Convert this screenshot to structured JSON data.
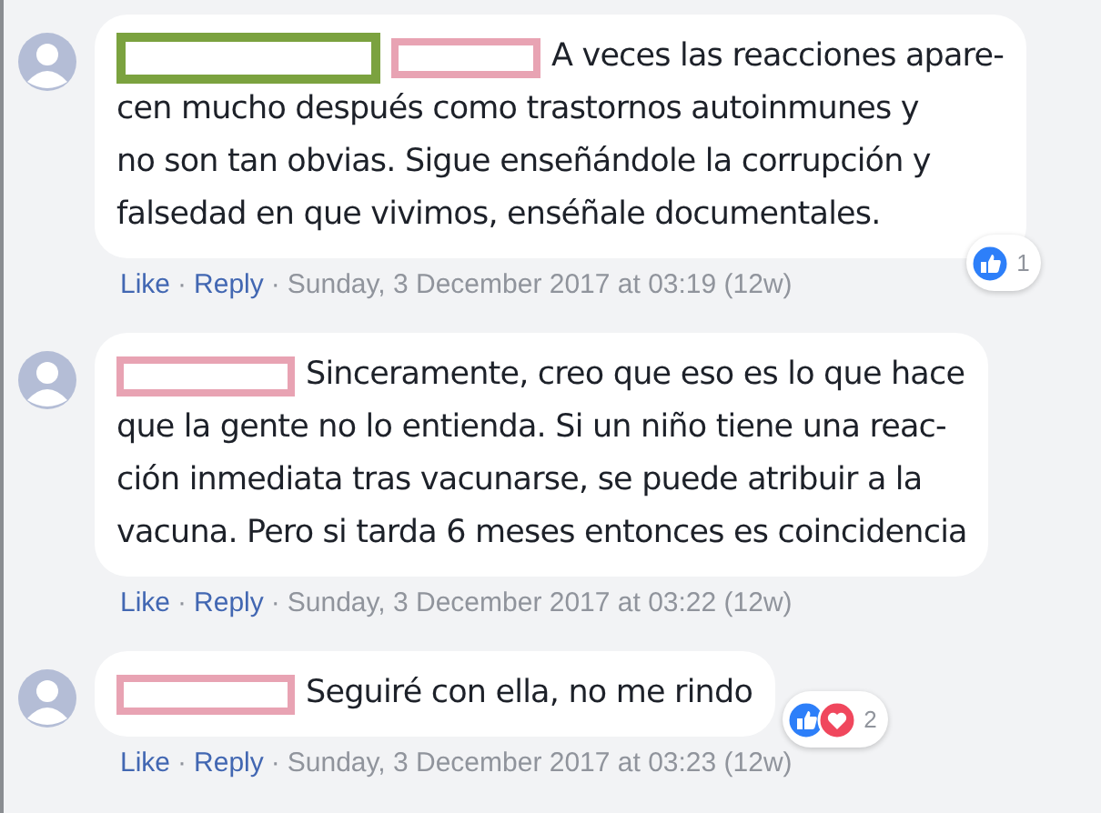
{
  "comments": [
    {
      "redactions": [
        {
          "color": "#7ba23f"
        },
        {
          "color": "#e8a3b3"
        }
      ],
      "lines": [
        "A veces las reacciones apare-",
        "cen mucho después como trastornos autoinmunes y",
        "no son tan obvias. Sigue enseñándole la corrupción y",
        "falsedad en que vivimos, enséñale documentales."
      ],
      "reactions": {
        "icons": [
          {
            "kind": "like"
          }
        ],
        "count": "1"
      },
      "actions": [
        {
          "kind": "link",
          "text": "Like"
        },
        {
          "kind": "separator",
          "text": "·"
        },
        {
          "kind": "link",
          "text": "Reply"
        },
        {
          "kind": "separator",
          "text": "·"
        },
        {
          "kind": "timestamp",
          "text": "Sunday, 3 December 2017 at 03:19 (12w)"
        }
      ]
    },
    {
      "redactions": [
        {
          "color": "#e8a3b3"
        }
      ],
      "lines": [
        "Sinceramente, creo que eso es lo que hace",
        "que la gente no lo entienda. Si un niño tiene una reac-",
        "ción inmediata tras vacunarse, se puede atribuir a la",
        "vacuna. Pero si tarda 6 meses entonces es coincidencia"
      ],
      "actions": [
        {
          "kind": "link",
          "text": "Like"
        },
        {
          "kind": "separator",
          "text": "·"
        },
        {
          "kind": "link",
          "text": "Reply"
        },
        {
          "kind": "separator",
          "text": "·"
        },
        {
          "kind": "timestamp",
          "text": "Sunday, 3 December 2017 at 03:22 (12w)"
        }
      ]
    },
    {
      "redactions": [
        {
          "color": "#e8a3b3"
        }
      ],
      "lines": [
        "Seguiré con ella, no me rindo"
      ],
      "reactions": {
        "icons": [
          {
            "kind": "like"
          },
          {
            "kind": "heart"
          }
        ],
        "count": "2"
      },
      "actions": [
        {
          "kind": "link",
          "text": "Like"
        },
        {
          "kind": "separator",
          "text": "·"
        },
        {
          "kind": "link",
          "text": "Reply"
        },
        {
          "kind": "separator",
          "text": "·"
        },
        {
          "kind": "timestamp",
          "text": "Sunday, 3 December 2017 at 03:23 (12w)"
        }
      ]
    }
  ]
}
